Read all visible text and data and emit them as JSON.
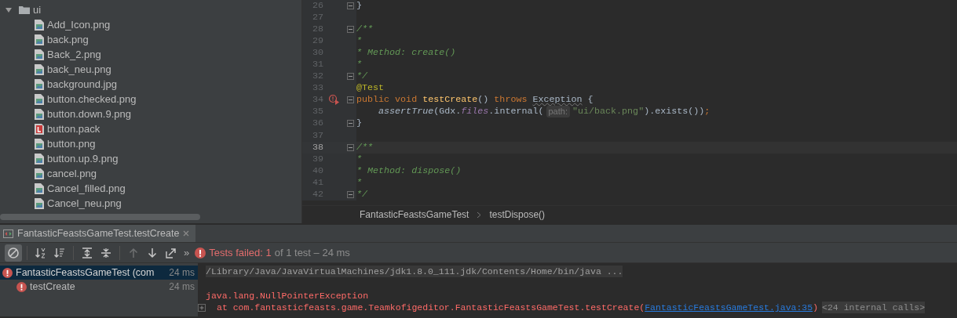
{
  "project_tree": {
    "folder": {
      "name": "ui",
      "expanded": true,
      "children": [
        {
          "name": "Add_Icon.png",
          "kind": "image"
        },
        {
          "name": "back.png",
          "kind": "image"
        },
        {
          "name": "Back_2.png",
          "kind": "image"
        },
        {
          "name": "back_neu.png",
          "kind": "image"
        },
        {
          "name": "background.jpg",
          "kind": "image"
        },
        {
          "name": "button.checked.png",
          "kind": "image"
        },
        {
          "name": "button.down.9.png",
          "kind": "image"
        },
        {
          "name": "button.pack",
          "kind": "pack"
        },
        {
          "name": "button.png",
          "kind": "image"
        },
        {
          "name": "button.up.9.png",
          "kind": "image"
        },
        {
          "name": "cancel.png",
          "kind": "image"
        },
        {
          "name": "Cancel_filled.png",
          "kind": "image"
        },
        {
          "name": "Cancel_neu.png",
          "kind": "image"
        }
      ]
    }
  },
  "editor": {
    "lines": [
      {
        "number": "26",
        "current": false,
        "fold": true,
        "test_failed": false,
        "tokens": [
          {
            "text": "}",
            "kind": "plain"
          }
        ]
      },
      {
        "number": "27",
        "current": false,
        "fold": false,
        "test_failed": false
      },
      {
        "number": "28",
        "current": false,
        "fold": true,
        "test_failed": false,
        "tokens": [
          {
            "text": "/**",
            "kind": "comment"
          }
        ]
      },
      {
        "number": "29",
        "current": false,
        "fold": false,
        "test_failed": false,
        "tokens": [
          {
            "text": "*",
            "kind": "comment"
          }
        ]
      },
      {
        "number": "30",
        "current": false,
        "fold": false,
        "test_failed": false,
        "tokens": [
          {
            "text": "* Method: create()",
            "kind": "comment"
          }
        ]
      },
      {
        "number": "31",
        "current": false,
        "fold": false,
        "test_failed": false,
        "tokens": [
          {
            "text": "*",
            "kind": "comment"
          }
        ]
      },
      {
        "number": "32",
        "current": false,
        "fold": true,
        "test_failed": false,
        "tokens": [
          {
            "text": "*/",
            "kind": "comment"
          }
        ]
      },
      {
        "number": "33",
        "current": false,
        "fold": false,
        "test_failed": false,
        "tokens": [
          {
            "text": "@Test",
            "kind": "annotation"
          }
        ]
      },
      {
        "number": "34",
        "current": false,
        "fold": true,
        "test_failed": true,
        "tokens": [
          {
            "text": "public void ",
            "kind": "keyword"
          },
          {
            "text": "testCreate",
            "kind": "declaration"
          },
          {
            "text": "() ",
            "kind": "plain"
          },
          {
            "text": "throws ",
            "kind": "keyword"
          },
          {
            "text": "Exception",
            "kind": "warning"
          },
          {
            "text": " {",
            "kind": "plain"
          }
        ]
      },
      {
        "number": "35",
        "current": false,
        "fold": false,
        "test_failed": false,
        "tokens": [
          {
            "text": "    assertTrue",
            "kind": "static"
          },
          {
            "text": "(Gdx.",
            "kind": "plain"
          },
          {
            "text": "files",
            "kind": "field"
          },
          {
            "text": ".internal(",
            "kind": "plain"
          },
          {
            "text": "path:",
            "kind": "hint"
          },
          {
            "text": "\"ui/back.png\"",
            "kind": "string"
          },
          {
            "text": ").exists())",
            "kind": "plain"
          },
          {
            "text": ";",
            "kind": "keyword"
          }
        ]
      },
      {
        "number": "36",
        "current": false,
        "fold": true,
        "test_failed": false,
        "tokens": [
          {
            "text": "}",
            "kind": "plain"
          }
        ]
      },
      {
        "number": "37",
        "current": false,
        "fold": false,
        "test_failed": false
      },
      {
        "number": "38",
        "current": true,
        "fold": true,
        "test_failed": false,
        "tokens": [
          {
            "text": "/**",
            "kind": "comment"
          }
        ]
      },
      {
        "number": "39",
        "current": false,
        "fold": false,
        "test_failed": false,
        "tokens": [
          {
            "text": "*",
            "kind": "comment"
          }
        ]
      },
      {
        "number": "40",
        "current": false,
        "fold": false,
        "test_failed": false,
        "tokens": [
          {
            "text": "* Method: dispose()",
            "kind": "comment"
          }
        ]
      },
      {
        "number": "41",
        "current": false,
        "fold": false,
        "test_failed": false,
        "tokens": [
          {
            "text": "*",
            "kind": "comment"
          }
        ]
      },
      {
        "number": "42",
        "current": false,
        "fold": true,
        "test_failed": false,
        "tokens": [
          {
            "text": "*/",
            "kind": "comment"
          }
        ]
      }
    ],
    "breadcrumbs": [
      "FantasticFeastsGameTest",
      "testDispose()"
    ]
  },
  "run_panel": {
    "tab": {
      "label": "FantasticFeastsGameTest.testCreate",
      "selected": true
    },
    "toolbar": [
      {
        "kind": "cancel",
        "selected": true,
        "disabled": false
      },
      {
        "kind": "alphabetical",
        "selected": false,
        "disabled": false
      },
      {
        "kind": "duration",
        "selected": false,
        "disabled": false
      },
      {
        "kind": "expand",
        "selected": false,
        "disabled": false
      },
      {
        "kind": "collapse",
        "selected": false,
        "disabled": false
      },
      {
        "kind": "previous",
        "selected": false,
        "disabled": true
      },
      {
        "kind": "next",
        "selected": false,
        "disabled": false
      },
      {
        "kind": "export",
        "selected": false,
        "disabled": false
      }
    ],
    "more": "»",
    "status": {
      "failed": "Tests failed: 1",
      "rest": "of 1 test – 24 ms"
    },
    "tests": [
      {
        "label": "FantasticFeastsGameTest (com",
        "time": "24 ms",
        "failed": true,
        "selected": true,
        "children": [
          {
            "label": "testCreate",
            "time": "24 ms",
            "failed": true,
            "selected": false
          }
        ]
      }
    ],
    "console": [
      {
        "kind": "command",
        "text": "/Library/Java/JavaVirtualMachines/jdk1.8.0_111.jdk/Contents/Home/bin/java ..."
      },
      {
        "kind": "blank"
      },
      {
        "kind": "error",
        "text": "java.lang.NullPointerException"
      },
      {
        "kind": "trace",
        "text": "at com.fantasticfeasts.game.Teamkofigeditor.FantasticFeastsGameTest.testCreate(",
        "link": "FantasticFeastsGameTest.java:35",
        "close": ")",
        "folded": "<24 internal calls>"
      }
    ]
  }
}
